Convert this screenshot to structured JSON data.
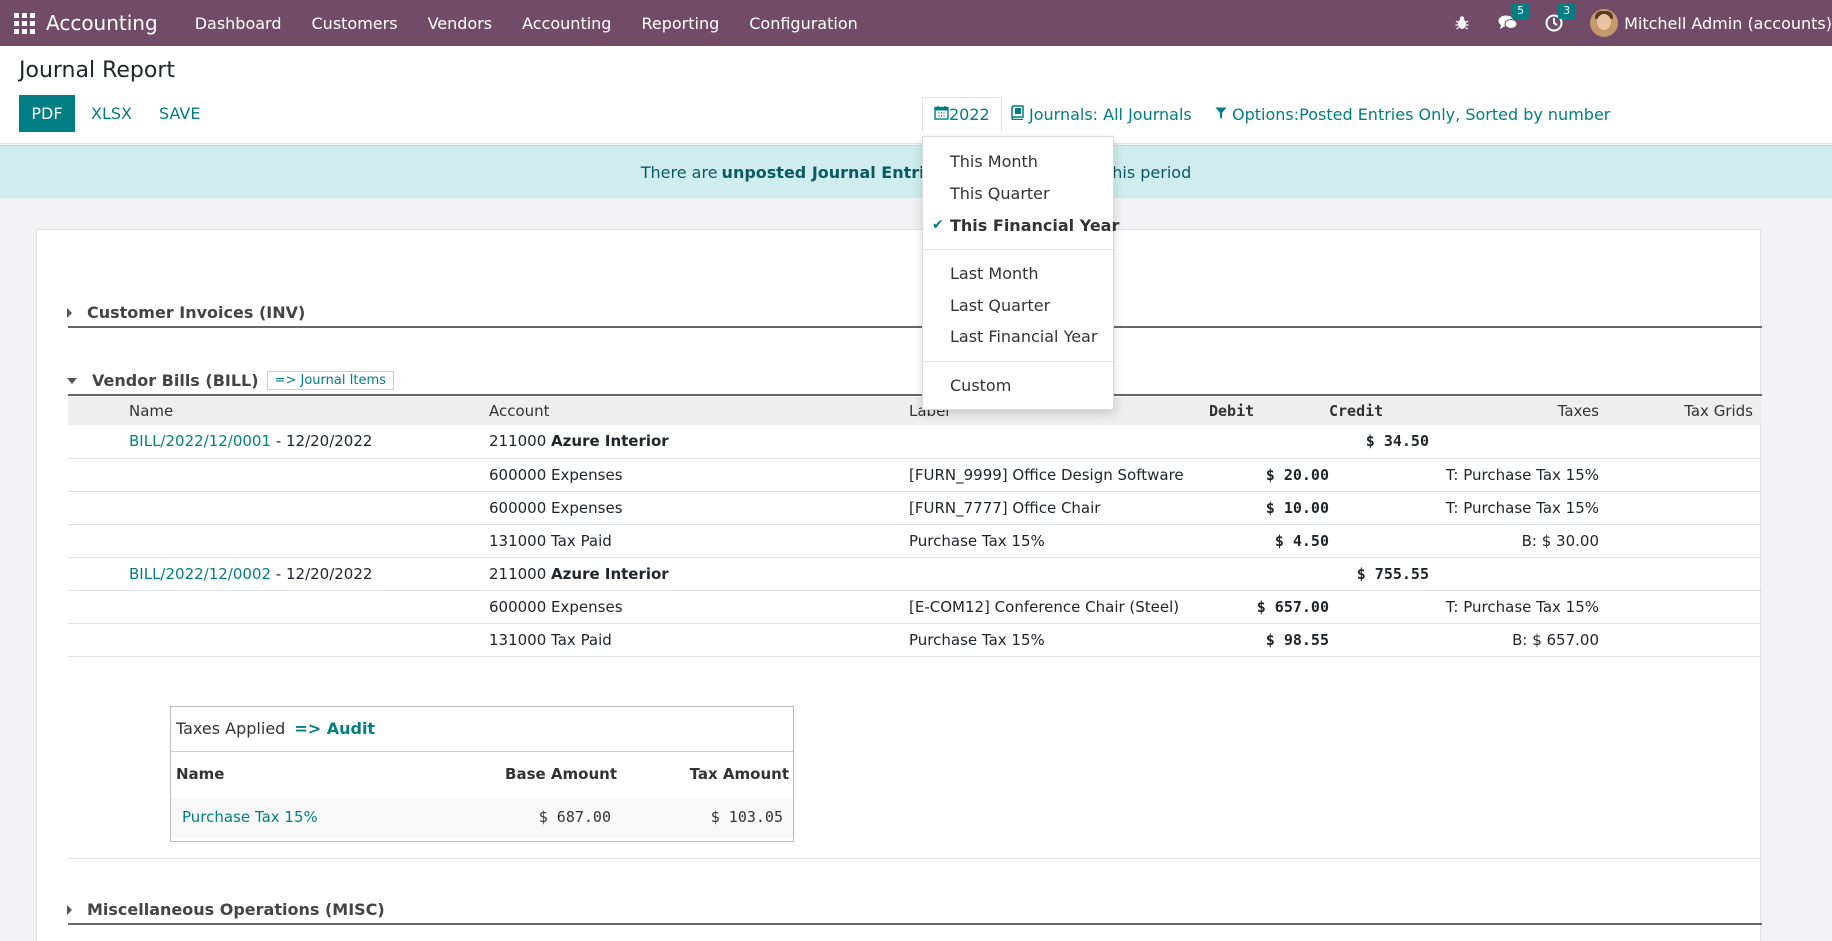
{
  "navbar": {
    "brand": "Accounting",
    "menu": [
      "Dashboard",
      "Customers",
      "Vendors",
      "Accounting",
      "Reporting",
      "Configuration"
    ],
    "messages_badge": "5",
    "activities_badge": "3",
    "user": "Mitchell Admin (accounts)"
  },
  "control_panel": {
    "title": "Journal Report",
    "pdf": "PDF",
    "xlsx": "XLSX",
    "save": "SAVE",
    "date_filter": "2022",
    "journals_filter": "Journals: All Journals",
    "options_filter": "Options:Posted Entries Only, Sorted by number"
  },
  "alert": {
    "prefix": "There are",
    "strong": "unposted Journal Entries",
    "suffix": "prior or included in this period"
  },
  "date_dropdown": {
    "groups": [
      [
        "This Month",
        "This Quarter",
        "This Financial Year"
      ],
      [
        "Last Month",
        "Last Quarter",
        "Last Financial Year"
      ],
      [
        "Custom"
      ]
    ],
    "selected": "This Financial Year"
  },
  "report": {
    "sections": {
      "inv": "Customer Invoices (INV)",
      "bill": "Vendor Bills (BILL)",
      "misc": "Miscellaneous Operations (MISC)"
    },
    "journal_items_link": "=> Journal Items",
    "columns": {
      "name": "Name",
      "account": "Account",
      "label": "Label",
      "debit": "Debit",
      "credit": "Credit",
      "taxes": "Taxes",
      "tax_grids": "Tax Grids"
    },
    "rows": [
      {
        "move": "BILL/2022/12/0001",
        "date": " - 12/20/2022",
        "account_code": "211000",
        "account_name": "Azure Interior",
        "label": "",
        "debit": "",
        "credit": "$ 34.50",
        "taxes": ""
      },
      {
        "move": "",
        "date": "",
        "account_code": "600000",
        "account_name": "Expenses",
        "label": "[FURN_9999] Office Design Software",
        "debit": "$ 20.00",
        "credit": "",
        "taxes": "T: Purchase Tax 15%"
      },
      {
        "move": "",
        "date": "",
        "account_code": "600000",
        "account_name": "Expenses",
        "label": "[FURN_7777] Office Chair",
        "debit": "$ 10.00",
        "credit": "",
        "taxes": "T: Purchase Tax 15%"
      },
      {
        "move": "",
        "date": "",
        "account_code": "131000",
        "account_name": "Tax Paid",
        "label": "Purchase Tax 15%",
        "debit": "$ 4.50",
        "credit": "",
        "taxes": "B: $ 30.00"
      },
      {
        "move": "BILL/2022/12/0002",
        "date": " - 12/20/2022",
        "account_code": "211000",
        "account_name": "Azure Interior",
        "label": "",
        "debit": "",
        "credit": "$ 755.55",
        "taxes": ""
      },
      {
        "move": "",
        "date": "",
        "account_code": "600000",
        "account_name": "Expenses",
        "label": "[E-COM12] Conference Chair (Steel)",
        "debit": "$ 657.00",
        "credit": "",
        "taxes": "T: Purchase Tax 15%"
      },
      {
        "move": "",
        "date": "",
        "account_code": "131000",
        "account_name": "Tax Paid",
        "label": "Purchase Tax 15%",
        "debit": "$ 98.55",
        "credit": "",
        "taxes": "B: $ 657.00"
      }
    ],
    "taxes_applied": {
      "title": "Taxes Applied",
      "audit": "=> Audit",
      "columns": {
        "name": "Name",
        "base": "Base Amount",
        "tax": "Tax Amount"
      },
      "rows": [
        {
          "name": "Purchase Tax 15%",
          "base": "$ 687.00",
          "tax": "$ 103.05"
        }
      ]
    }
  }
}
